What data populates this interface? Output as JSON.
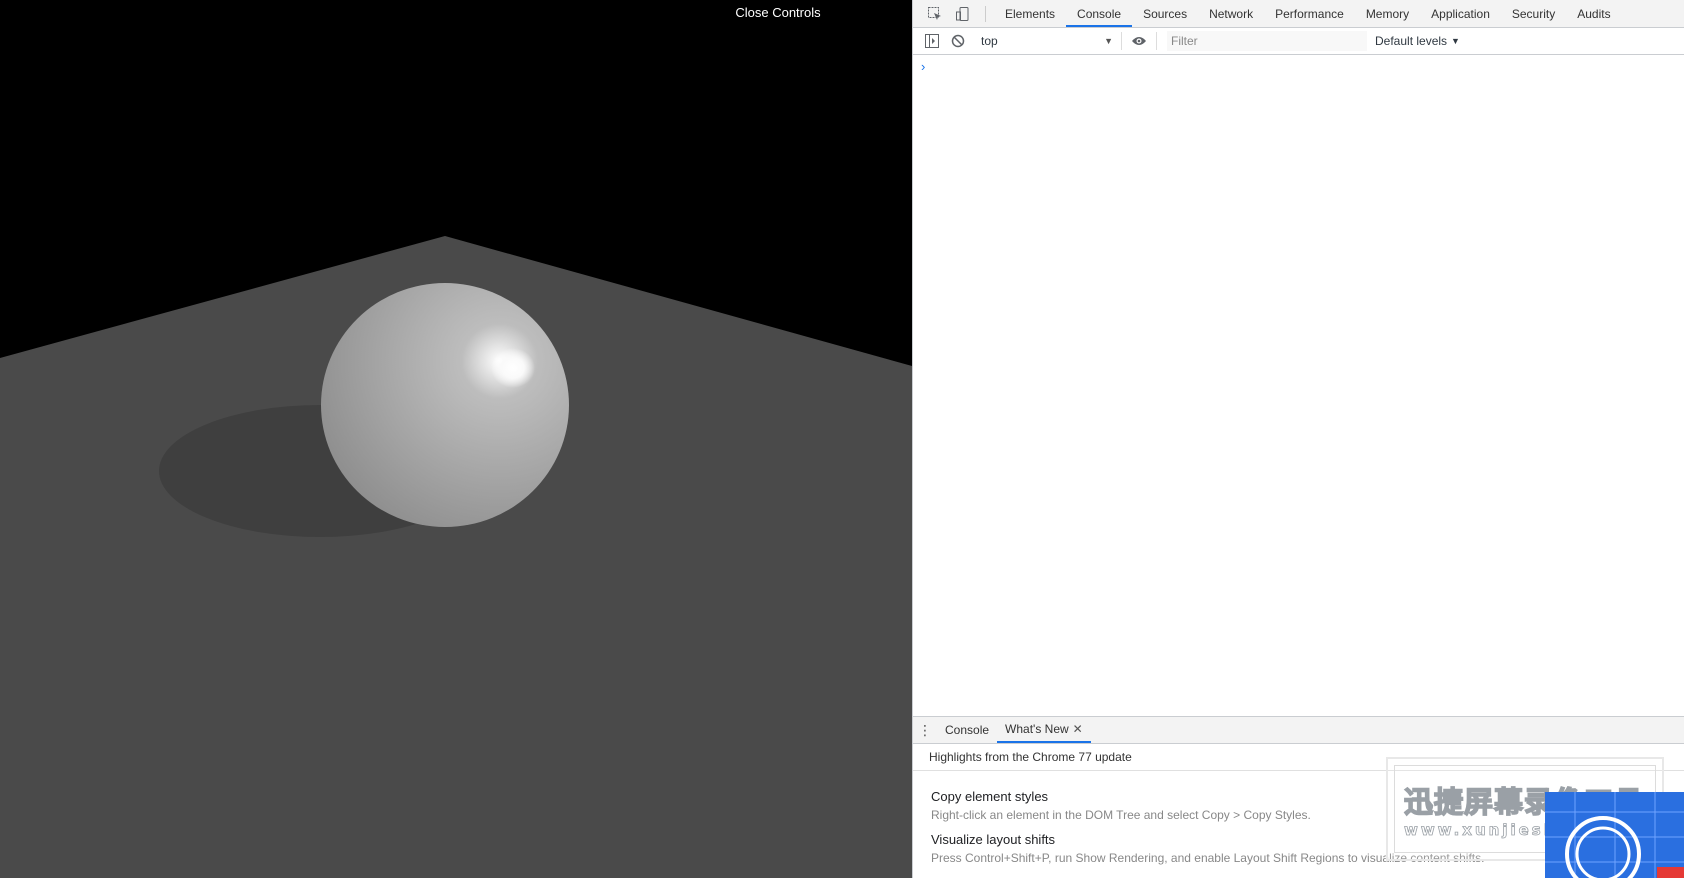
{
  "viewport": {
    "close_controls_label": "Close Controls",
    "background": "#000000",
    "floor_color": "#4a4a4a",
    "sphere_color": "#a8a8a8",
    "shadow_color": "#3e3e3e"
  },
  "devtools": {
    "tabs": [
      {
        "label": "Elements",
        "active": false
      },
      {
        "label": "Console",
        "active": true
      },
      {
        "label": "Sources",
        "active": false
      },
      {
        "label": "Network",
        "active": false
      },
      {
        "label": "Performance",
        "active": false
      },
      {
        "label": "Memory",
        "active": false
      },
      {
        "label": "Application",
        "active": false
      },
      {
        "label": "Security",
        "active": false
      },
      {
        "label": "Audits",
        "active": false
      }
    ],
    "toolbar": {
      "context": "top",
      "filter_placeholder": "Filter",
      "levels_label": "Default levels"
    },
    "console": {
      "prompt_symbol": "›"
    },
    "drawer": {
      "tabs": [
        {
          "label": "Console",
          "active": false
        },
        {
          "label": "What's New",
          "active": true,
          "closable": true
        }
      ],
      "highlights": "Highlights from the Chrome 77 update",
      "features": [
        {
          "title": "Copy element styles",
          "desc": "Right-click an element in the DOM Tree and select Copy > Copy Styles."
        },
        {
          "title": "Visualize layout shifts",
          "desc": "Press Control+Shift+P, run Show Rendering, and enable Layout Shift Regions to visualize content shifts."
        }
      ]
    },
    "accent_color": "#1a73e8"
  },
  "watermark": {
    "title": "迅捷屏幕录像工具",
    "url": "www.xunjieshipin.com"
  }
}
